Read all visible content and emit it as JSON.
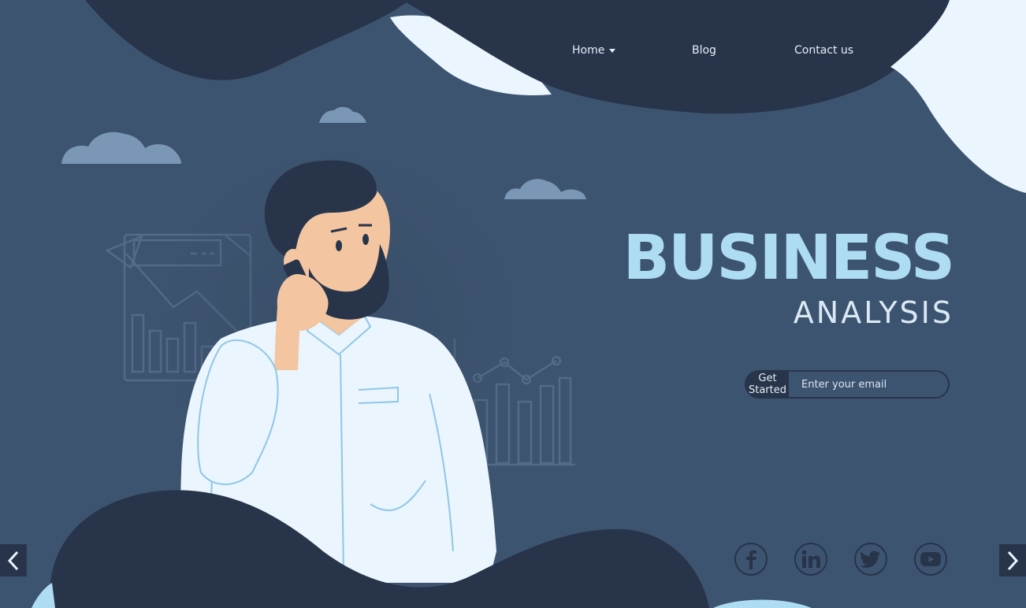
{
  "nav": {
    "items": [
      {
        "label": "Home",
        "has_dropdown": true
      },
      {
        "label": "Blog",
        "has_dropdown": false
      },
      {
        "label": "Contact us",
        "has_dropdown": false
      }
    ]
  },
  "hero": {
    "title": "BUSINESS",
    "subtitle": "ANALYSIS"
  },
  "cta": {
    "button_label": "Get Started",
    "email_placeholder": "Enter your email",
    "email_value": ""
  },
  "social": [
    {
      "icon": "facebook-icon",
      "glyph": "f"
    },
    {
      "icon": "linkedin-icon",
      "glyph": "in"
    },
    {
      "icon": "twitter-icon",
      "glyph": "bird"
    },
    {
      "icon": "youtube-icon",
      "glyph": "play"
    }
  ],
  "carousel": {
    "prev_icon": "chevron-left-icon",
    "next_icon": "chevron-right-icon"
  },
  "colors": {
    "background": "#3d5470",
    "dark_navy": "#27344a",
    "accent_light_blue": "#aedcf3",
    "off_white": "#eaf5fd",
    "shirt_line": "#8fc7e6"
  }
}
